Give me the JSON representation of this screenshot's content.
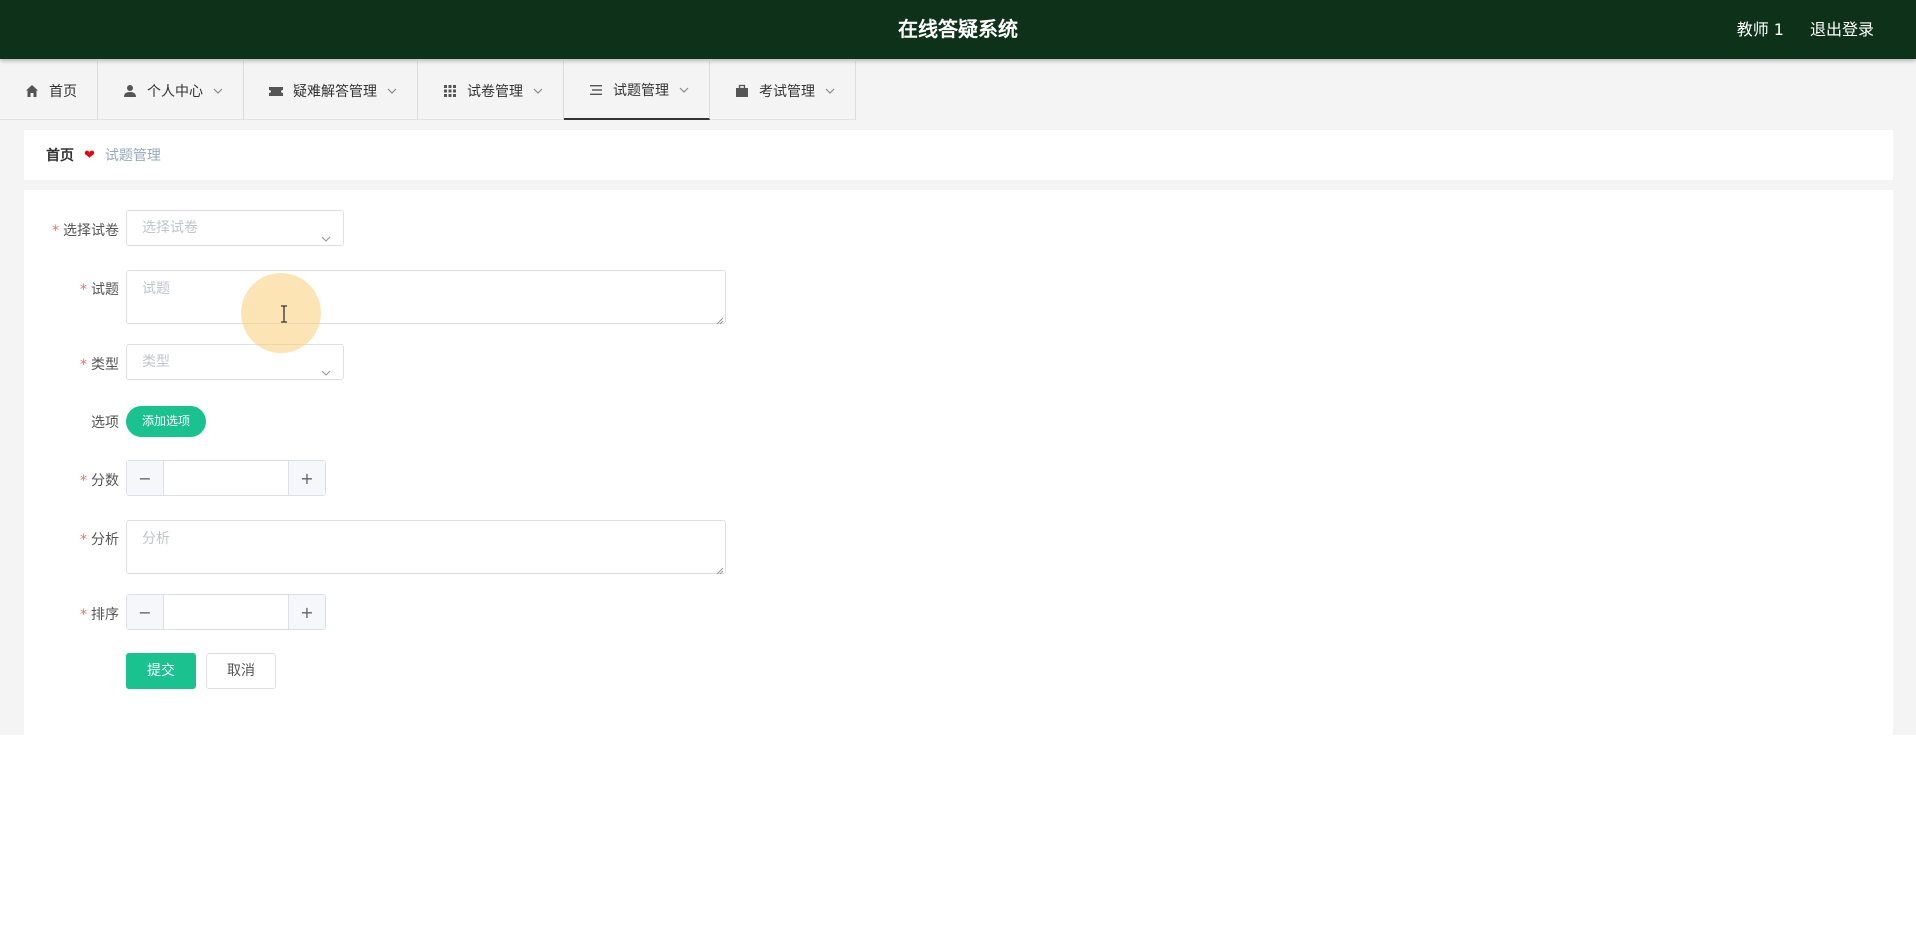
{
  "header": {
    "title": "在线答疑系统",
    "user": "教师 1",
    "logout": "退出登录"
  },
  "nav": {
    "items": [
      {
        "label": "首页",
        "icon": "home-icon",
        "has_dropdown": false
      },
      {
        "label": "个人中心",
        "icon": "user-icon",
        "has_dropdown": true
      },
      {
        "label": "疑难解答管理",
        "icon": "ticket-icon",
        "has_dropdown": true
      },
      {
        "label": "试卷管理",
        "icon": "grid-icon",
        "has_dropdown": true
      },
      {
        "label": "试题管理",
        "icon": "list-icon",
        "has_dropdown": true,
        "active": true
      },
      {
        "label": "考试管理",
        "icon": "briefcase-icon",
        "has_dropdown": true
      }
    ]
  },
  "breadcrumb": {
    "home": "首页",
    "current": "试题管理"
  },
  "form": {
    "paper": {
      "label": "选择试卷",
      "placeholder": "选择试卷",
      "required": true
    },
    "question": {
      "label": "试题",
      "placeholder": "试题",
      "required": true
    },
    "type": {
      "label": "类型",
      "placeholder": "类型",
      "required": true
    },
    "options": {
      "label": "选项",
      "button": "添加选项",
      "required": false
    },
    "score": {
      "label": "分数",
      "value": "",
      "required": true
    },
    "analysis": {
      "label": "分析",
      "placeholder": "分析",
      "required": true
    },
    "order": {
      "label": "排序",
      "value": "",
      "required": true
    },
    "submit": "提交",
    "cancel": "取消",
    "required_mark": "*"
  },
  "colors": {
    "header_bg": "#0e311a",
    "primary": "#19c28e",
    "required": "#f56c6c",
    "heart": "#e60012"
  }
}
